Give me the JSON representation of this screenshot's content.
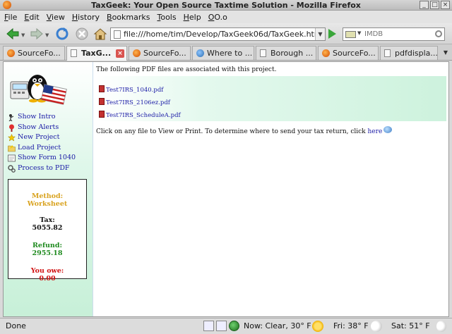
{
  "window": {
    "title": "TaxGeek: Your Open Source Taxtime Solution - Mozilla Firefox"
  },
  "menu": [
    "File",
    "Edit",
    "View",
    "History",
    "Bookmarks",
    "Tools",
    "Help",
    "OO.o"
  ],
  "nav": {
    "url": "file:///home/tim/Develop/TaxGeek06d/TaxGeek.htm",
    "search_placeholder": "IMDB"
  },
  "tabs": [
    {
      "label": "SourceFo...",
      "icon": "firefox-icon",
      "active": false
    },
    {
      "label": "TaxG...",
      "icon": "page-icon",
      "active": true
    },
    {
      "label": "SourceFo...",
      "icon": "firefox-icon",
      "active": false
    },
    {
      "label": "Where to ...",
      "icon": "globe-icon",
      "active": false
    },
    {
      "label": "Borough ...",
      "icon": "page-icon",
      "active": false
    },
    {
      "label": "SourceFo...",
      "icon": "firefox-icon",
      "active": false
    },
    {
      "label": "pdfdispla...",
      "icon": "page-icon",
      "active": false
    }
  ],
  "sidebar": {
    "links": [
      {
        "label": "Show Intro",
        "icon": "intro-icon"
      },
      {
        "label": "Show Alerts",
        "icon": "alert-icon"
      },
      {
        "label": "New Project",
        "icon": "star-icon"
      },
      {
        "label": "Load Project",
        "icon": "folder-icon"
      },
      {
        "label": "Show Form 1040",
        "icon": "form-icon"
      },
      {
        "label": "Process to PDF",
        "icon": "gears-icon"
      }
    ],
    "summary": {
      "method_label": "Method:",
      "method_value": "Worksheet",
      "tax_label": "Tax:",
      "tax_value": "5055.82",
      "refund_label": "Refund:",
      "refund_value": "2955.18",
      "owe_label": "You owe:",
      "owe_value": "0.00"
    }
  },
  "main": {
    "intro": "The following PDF files are associated with this project.",
    "pdf_files": [
      "Test7IRS_1040.pdf",
      "Test7IRS_2106ez.pdf",
      "Test7IRS_ScheduleA.pdf"
    ],
    "footer_text": "Click on any file to View or Print. To determine where to send your tax return, click",
    "footer_link": "here"
  },
  "status": {
    "text": "Done",
    "weather_now": "Now: Clear, 30° F",
    "weather_fri": "Fri: 38° F",
    "weather_sat": "Sat: 51° F"
  },
  "colors": {
    "link": "#1a1aa6",
    "method": "#d9a320",
    "refund": "#1e8a1e",
    "owe": "#d01010",
    "sidebar_green": "#c7f0d8"
  }
}
